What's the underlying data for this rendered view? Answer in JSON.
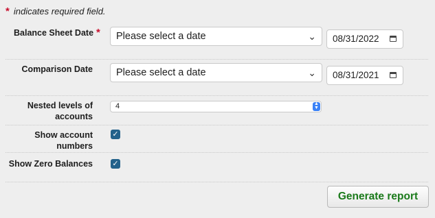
{
  "required_note": {
    "star": "*",
    "text": "indicates required field."
  },
  "balance_sheet": {
    "label": "Balance Sheet Date",
    "star": "*",
    "select_value": "Please select a date",
    "date_value": "08/31/2022"
  },
  "comparison": {
    "label": "Comparison Date",
    "select_value": "Please select a date",
    "date_value": "08/31/2021"
  },
  "nested": {
    "label_line1": "Nested levels of",
    "label_line2": "accounts",
    "value": "4"
  },
  "show_account_numbers": {
    "label_line1": "Show account",
    "label_line2": "numbers",
    "checked": true
  },
  "show_zero_balances": {
    "label": "Show Zero Balances",
    "checked": true
  },
  "generate_button": {
    "label": "Generate report"
  },
  "icons": {
    "select_chevron": "chevron-down-icon",
    "calendar": "calendar-icon",
    "checkmark": "checkmark-icon",
    "stepper": "up-down-stepper-icon"
  }
}
